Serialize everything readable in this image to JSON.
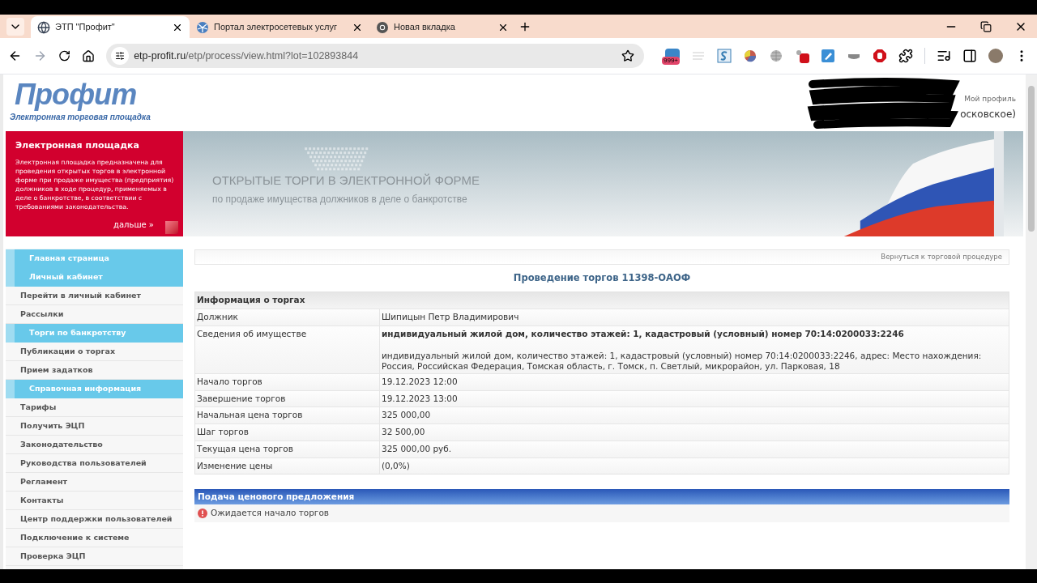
{
  "browser": {
    "tabs": [
      {
        "title": "ЭТП \"Профит\"",
        "selected": true
      },
      {
        "title": "Портал электросетевых услуг",
        "selected": false
      },
      {
        "title": "Новая вкладка",
        "selected": false
      }
    ],
    "url_domain": "etp-profit.ru",
    "url_path": "/etp/process/view.html?lot=102893844",
    "extension_badge": "999+"
  },
  "header": {
    "logo": "Профит",
    "logo_subtitle": "Электронная торговая площадка",
    "profile_link": "Мой профиль",
    "profile_text": "осковское)"
  },
  "banner": {
    "promo_title": "Электронная площадка",
    "promo_text": "Электронная площадка предназначена для проведения открытых торгов в электронной форме при продаже имущества (предприятия) должников в ходе процедур, применяемых в деле о банкротстве, в соответствии с требованиями законодательства.",
    "promo_link": "дальше »",
    "headline": "ОТКРЫТЫЕ ТОРГИ В ЭЛЕКТРОННОЙ ФОРМЕ",
    "subheadline": "по продаже имущества должников в деле о банкротстве"
  },
  "sidebar": {
    "items": [
      {
        "label": "Главная страница",
        "kind": "section"
      },
      {
        "label": "Личный кабинет",
        "kind": "section"
      },
      {
        "label": "Перейти в личный кабинет",
        "kind": "link"
      },
      {
        "label": "Рассылки",
        "kind": "link"
      },
      {
        "label": "Торги по банкротству",
        "kind": "section"
      },
      {
        "label": "Публикации о торгах",
        "kind": "link"
      },
      {
        "label": "Прием задатков",
        "kind": "link"
      },
      {
        "label": "Справочная информация",
        "kind": "section"
      },
      {
        "label": "Тарифы",
        "kind": "link"
      },
      {
        "label": "Получить ЭЦП",
        "kind": "link"
      },
      {
        "label": "Законодательство",
        "kind": "link"
      },
      {
        "label": "Руководства пользователей",
        "kind": "link"
      },
      {
        "label": "Регламент",
        "kind": "link"
      },
      {
        "label": "Контакты",
        "kind": "link"
      },
      {
        "label": "Центр поддержки пользователей",
        "kind": "link"
      },
      {
        "label": "Подключение к системе",
        "kind": "link"
      },
      {
        "label": "Проверка ЭЦП",
        "kind": "link"
      }
    ]
  },
  "main": {
    "back_link": "Вернуться к торговой процедуре",
    "title": "Проведение торгов 11398-ОАОФ",
    "info_table": {
      "heading": "Информация о торгах",
      "rows": [
        {
          "label": "Должник",
          "value": "Шипицын Петр Владимирович"
        },
        {
          "label": "Сведения об имуществе",
          "value": "индивидуальный жилой дом, количество этажей: 1, кадастровый (условный) номер 70:14:0200033:2246",
          "details": "индивидуальный жилой дом, количество этажей: 1, кадастровый (условный) номер 70:14:0200033:2246, адрес: Место нахождения: Россия, Российская Федерация, Томская область, г. Томск, п. Светлый, микрорайон, ул. Парковая, 18"
        },
        {
          "label": "Начало торгов",
          "value": "19.12.2023 12:00"
        },
        {
          "label": "Завершение торгов",
          "value": "19.12.2023 13:00"
        },
        {
          "label": "Начальная цена торгов",
          "value": "325 000,00"
        },
        {
          "label": "Шаг торгов",
          "value": "32 500,00"
        },
        {
          "label": "Текущая цена торгов",
          "value": "325 000,00 руб."
        },
        {
          "label": "Изменение цены",
          "value": "(0,0%)"
        }
      ]
    },
    "bid_section": {
      "heading": "Подача ценового предложения",
      "status": "Ожидается начало торгов"
    }
  }
}
